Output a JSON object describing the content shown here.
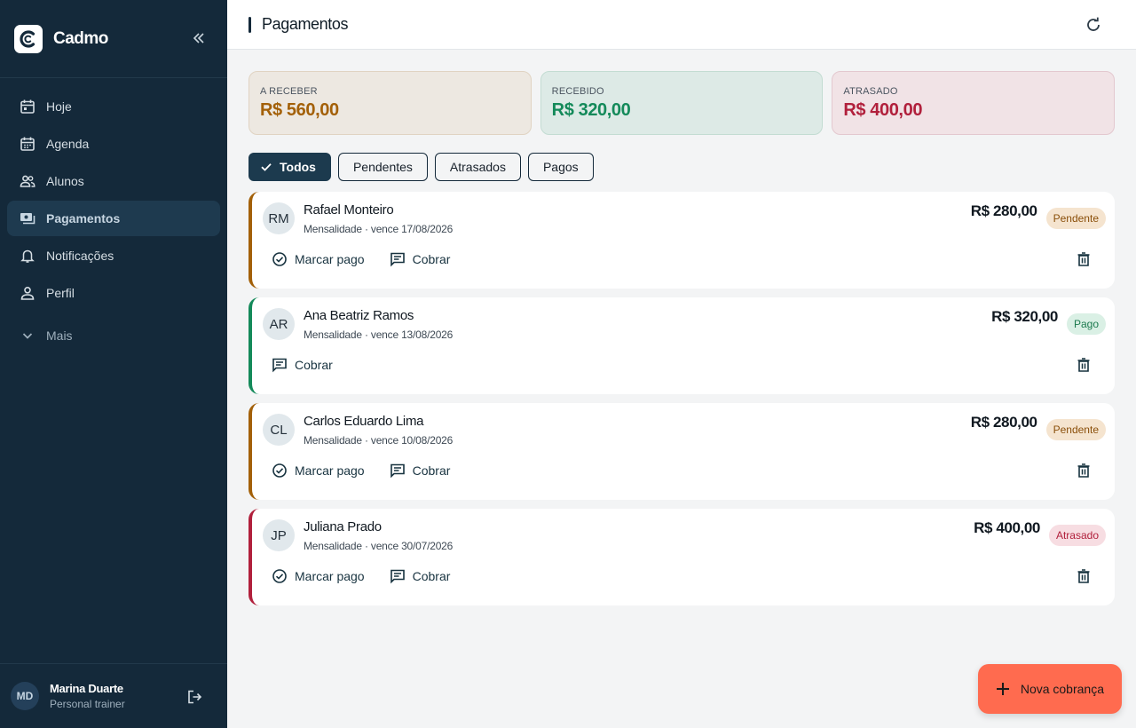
{
  "app": {
    "name": "Cadmo"
  },
  "sidebar": {
    "items": [
      {
        "label": "Hoje",
        "icon": "calendar-today-icon"
      },
      {
        "label": "Agenda",
        "icon": "calendar-month-icon"
      },
      {
        "label": "Alunos",
        "icon": "people-icon"
      },
      {
        "label": "Pagamentos",
        "icon": "payments-icon",
        "active": true
      },
      {
        "label": "Notificações",
        "icon": "bell-icon"
      },
      {
        "label": "Perfil",
        "icon": "person-icon"
      }
    ],
    "more_label": "Mais"
  },
  "user": {
    "initials": "MD",
    "name": "Marina Duarte",
    "role": "Personal trainer"
  },
  "header": {
    "title": "Pagamentos"
  },
  "summary": {
    "receivable": {
      "label": "A RECEBER",
      "value": "R$ 560,00",
      "color": "#a36008"
    },
    "received": {
      "label": "RECEBIDO",
      "value": "R$ 320,00",
      "color": "#148a5a"
    },
    "overdue": {
      "label": "ATRASADO",
      "value": "R$ 400,00",
      "color": "#b1203c"
    }
  },
  "filters": {
    "all": "Todos",
    "pending": "Pendentes",
    "overdue": "Atrasados",
    "paid": "Pagos"
  },
  "actions": {
    "mark_paid": "Marcar pago",
    "charge": "Cobrar"
  },
  "payments": [
    {
      "initials": "RM",
      "name": "Rafael Monteiro",
      "detail": "Mensalidade · vence 17/08/2026",
      "amount": "R$ 280,00",
      "status": "Pendente"
    },
    {
      "initials": "AR",
      "name": "Ana Beatriz Ramos",
      "detail": "Mensalidade · vence 13/08/2026",
      "amount": "R$ 320,00",
      "status": "Pago"
    },
    {
      "initials": "CL",
      "name": "Carlos Eduardo Lima",
      "detail": "Mensalidade · vence 10/08/2026",
      "amount": "R$ 280,00",
      "status": "Pendente"
    },
    {
      "initials": "JP",
      "name": "Juliana Prado",
      "detail": "Mensalidade · vence 30/07/2026",
      "amount": "R$ 400,00",
      "status": "Atrasado"
    }
  ],
  "fab": {
    "label": "Nova cobrança",
    "color": "#ff6b4f"
  }
}
